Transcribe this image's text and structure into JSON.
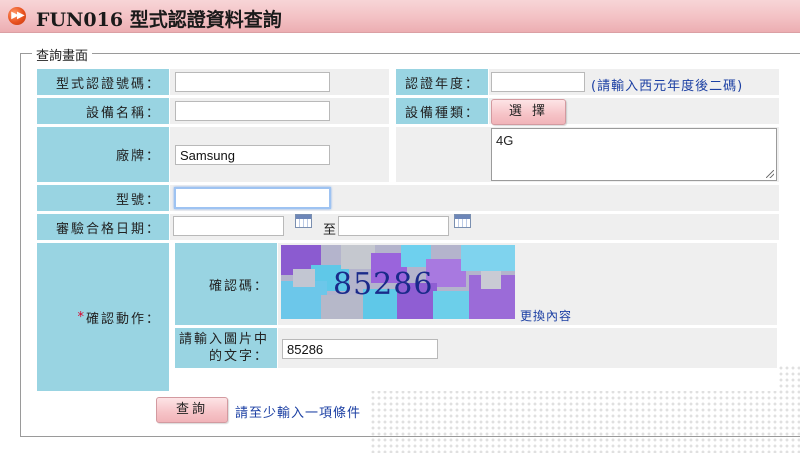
{
  "header": {
    "icon": "fast-forward-icon",
    "title": "FUN016 型式認證資料查詢"
  },
  "form": {
    "legend": "查詢畫面",
    "cert_no_label": "型式認證號碼：",
    "cert_no_value": "",
    "cert_year_label": "認證年度：",
    "cert_year_value": "",
    "cert_year_hint": "(請輸入西元年度後二碼)",
    "device_name_label": "設備名稱：",
    "device_name_value": "",
    "device_type_label": "設備種類：",
    "select_button": "選 擇",
    "device_type_value": "4G",
    "brand_label": "廠牌：",
    "brand_value": "Samsung",
    "model_label": "型號：",
    "model_value": "",
    "date_label": "審驗合格日期：",
    "date_from": "",
    "date_to_sep": "至",
    "date_to": "",
    "verify_label_required": "*",
    "verify_label": "確認動作：",
    "captcha_label": "確認碼：",
    "captcha_text": "85286",
    "refresh_link": "更換內容",
    "captcha_input_label_1": "請輸入圖片中",
    "captcha_input_label_2": "的文字：",
    "captcha_input_value": "85286",
    "search_button": "查詢",
    "search_hint": "請至少輸入一項條件"
  },
  "colors": {
    "label_bg": "#99d4e2",
    "value_bg": "#efefef",
    "link": "#1b3fa3",
    "required": "#d8002a"
  }
}
